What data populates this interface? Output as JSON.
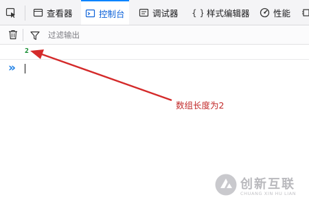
{
  "tabs": [
    {
      "label": "查看器",
      "icon": "inspector-icon"
    },
    {
      "label": "控制台",
      "icon": "console-icon",
      "selected": true
    },
    {
      "label": "调试器",
      "icon": "debugger-icon"
    },
    {
      "label": "样式编辑器",
      "icon": "style-editor-icon"
    },
    {
      "label": "性能",
      "icon": "performance-icon"
    }
  ],
  "filter": {
    "placeholder": "过滤输出"
  },
  "console": {
    "output": [
      "2"
    ]
  },
  "annotation": {
    "text": "数组长度为2",
    "color": "#c22a2a"
  },
  "watermark": {
    "title": "创新互联",
    "subtitle": "CHUANG XIN HU LIAN"
  },
  "colors": {
    "accent": "#0a84ff",
    "result": "#108a2c",
    "prompt": "#1c7fe6"
  }
}
